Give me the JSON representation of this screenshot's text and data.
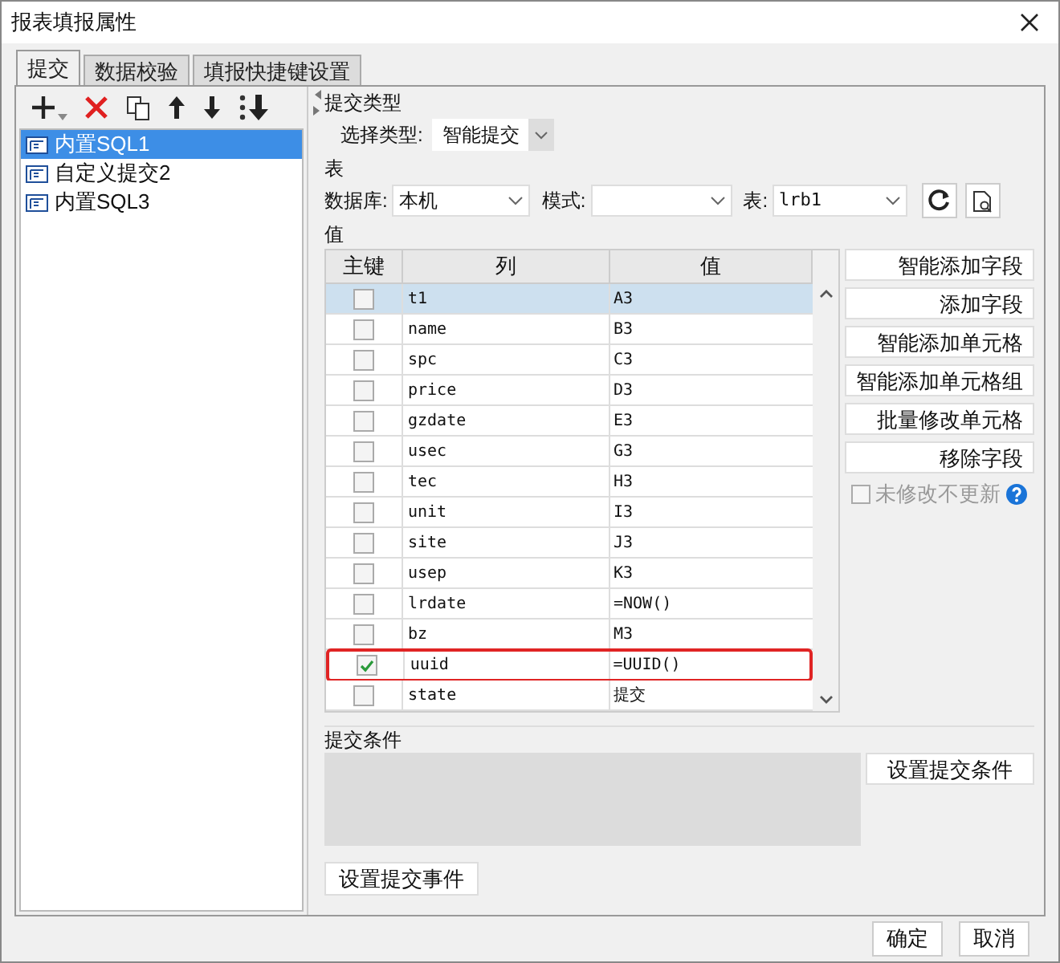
{
  "window": {
    "title": "报表填报属性"
  },
  "tabs": [
    {
      "label": "提交",
      "selected": true
    },
    {
      "label": "数据校验",
      "selected": false
    },
    {
      "label": "填报快捷键设置",
      "selected": false
    }
  ],
  "submissions": [
    {
      "label": "内置SQL1",
      "selected": true
    },
    {
      "label": "自定义提交2",
      "selected": false
    },
    {
      "label": "内置SQL3",
      "selected": false
    }
  ],
  "submit_type": {
    "heading": "提交类型",
    "label": "选择类型:",
    "value": "智能提交"
  },
  "table_section": {
    "heading": "表",
    "database_label": "数据库:",
    "database": "本机",
    "schema_label": "模式:",
    "table_label": "表:",
    "table": "lrb1"
  },
  "values": {
    "heading": "值",
    "columns": [
      "主键",
      "列",
      "值"
    ],
    "rows": [
      {
        "column": "t1",
        "value": "A3",
        "key": false,
        "selected": true,
        "highlighted": false
      },
      {
        "column": "name",
        "value": "B3",
        "key": false,
        "selected": false,
        "highlighted": false
      },
      {
        "column": "spc",
        "value": "C3",
        "key": false,
        "selected": false,
        "highlighted": false
      },
      {
        "column": "price",
        "value": "D3",
        "key": false,
        "selected": false,
        "highlighted": false
      },
      {
        "column": "gzdate",
        "value": "E3",
        "key": false,
        "selected": false,
        "highlighted": false
      },
      {
        "column": "usec",
        "value": "G3",
        "key": false,
        "selected": false,
        "highlighted": false
      },
      {
        "column": "tec",
        "value": "H3",
        "key": false,
        "selected": false,
        "highlighted": false
      },
      {
        "column": "unit",
        "value": "I3",
        "key": false,
        "selected": false,
        "highlighted": false
      },
      {
        "column": "site",
        "value": "J3",
        "key": false,
        "selected": false,
        "highlighted": false
      },
      {
        "column": "usep",
        "value": "K3",
        "key": false,
        "selected": false,
        "highlighted": false
      },
      {
        "column": "lrdate",
        "value": "=NOW()",
        "key": false,
        "selected": false,
        "highlighted": false
      },
      {
        "column": "bz",
        "value": "M3",
        "key": false,
        "selected": false,
        "highlighted": false
      },
      {
        "column": "uuid",
        "value": "=UUID()",
        "key": true,
        "selected": false,
        "highlighted": true
      },
      {
        "column": "state",
        "value": "提交",
        "key": false,
        "selected": false,
        "highlighted": false
      }
    ],
    "buttons": [
      "智能添加字段",
      "添加字段",
      "智能添加单元格",
      "智能添加单元格组",
      "批量修改单元格",
      "移除字段"
    ],
    "no_update_unmodified": {
      "label": "未修改不更新",
      "checked": false,
      "disabled": true
    }
  },
  "condition": {
    "heading": "提交条件",
    "button": "设置提交条件"
  },
  "event_button": "设置提交事件",
  "footer_buttons": [
    "确定",
    "取消"
  ]
}
